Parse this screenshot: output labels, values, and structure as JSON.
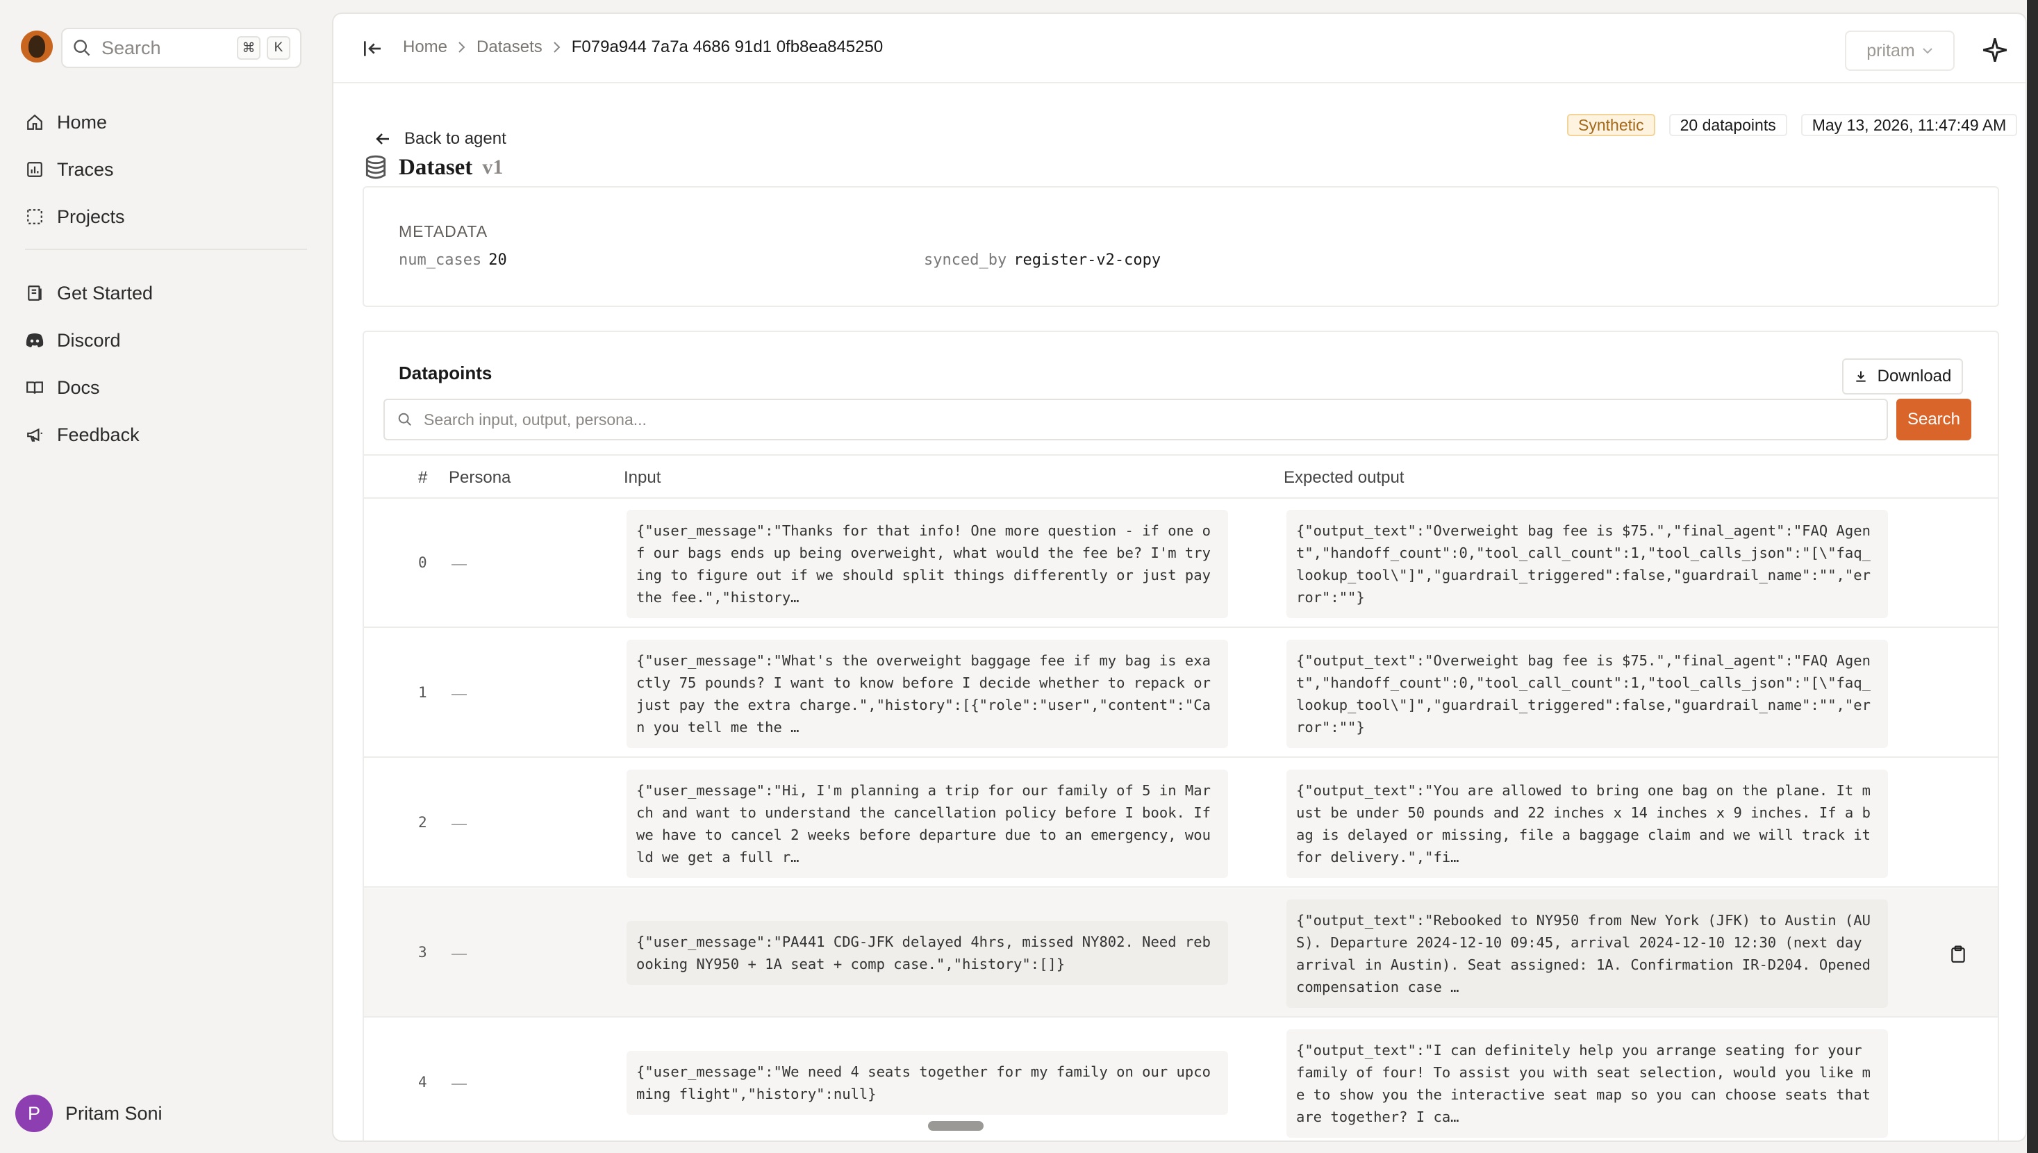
{
  "sidebar": {
    "search_placeholder": "Search",
    "shortcut_keys": [
      "⌘",
      "K"
    ],
    "nav_primary": [
      {
        "label": "Home",
        "icon": "home-icon"
      },
      {
        "label": "Traces",
        "icon": "chart-icon"
      },
      {
        "label": "Projects",
        "icon": "dotted-square-icon"
      }
    ],
    "nav_secondary": [
      {
        "label": "Get Started",
        "icon": "book-icon"
      },
      {
        "label": "Discord",
        "icon": "discord-icon"
      },
      {
        "label": "Docs",
        "icon": "docs-icon"
      },
      {
        "label": "Feedback",
        "icon": "megaphone-icon"
      }
    ],
    "user": {
      "initial": "P",
      "name": "Pritam Soni",
      "avatar_color": "#8d3fb1"
    }
  },
  "header": {
    "breadcrumb": [
      "Home",
      "Datasets"
    ],
    "current": "F079a944 7a7a 4686 91d1 0fb8ea845250",
    "user_select": "pritam"
  },
  "page": {
    "back_label": "Back to agent",
    "title": "Dataset",
    "version": "v1",
    "badges": {
      "type": "Synthetic",
      "count": "20 datapoints",
      "timestamp": "May 13, 2026, 11:47:49 AM"
    }
  },
  "metadata": {
    "label": "METADATA",
    "entries": [
      {
        "key": "num_cases",
        "value": "20"
      },
      {
        "key": "synced_by",
        "value": "register-v2-copy"
      }
    ]
  },
  "datapoints": {
    "title": "Datapoints",
    "download_label": "Download",
    "search_placeholder": "Search input, output, persona...",
    "search_button": "Search",
    "columns": [
      "#",
      "Persona",
      "Input",
      "Expected output"
    ],
    "rows": [
      {
        "index": "0",
        "input": "{\"user_message\":\"Thanks for that info! One more question - if one of our bags ends up being overweight, what would the fee be? I'm trying to figure out if we should split things differently or just pay the fee.\",\"history…",
        "output": "{\"output_text\":\"Overweight bag fee is $75.\",\"final_agent\":\"FAQ Agent\",\"handoff_count\":0,\"tool_call_count\":1,\"tool_calls_json\":\"[\\\"faq_lookup_tool\\\"]\",\"guardrail_triggered\":false,\"guardrail_name\":\"\",\"error\":\"\"}"
      },
      {
        "index": "1",
        "input": "{\"user_message\":\"What's the overweight baggage fee if my bag is exactly 75 pounds? I want to know before I decide whether to repack or just pay the extra charge.\",\"history\":[{\"role\":\"user\",\"content\":\"Can you tell me the …",
        "output": "{\"output_text\":\"Overweight bag fee is $75.\",\"final_agent\":\"FAQ Agent\",\"handoff_count\":0,\"tool_call_count\":1,\"tool_calls_json\":\"[\\\"faq_lookup_tool\\\"]\",\"guardrail_triggered\":false,\"guardrail_name\":\"\",\"error\":\"\"}"
      },
      {
        "index": "2",
        "input": "{\"user_message\":\"Hi, I'm planning a trip for our family of 5 in March and want to understand the cancellation policy before I book. If we have to cancel 2 weeks before departure due to an emergency, would we get a full r…",
        "output": "{\"output_text\":\"You are allowed to bring one bag on the plane. It must be under 50 pounds and 22 inches x 14 inches x 9 inches. If a bag is delayed or missing, file a baggage claim and we will track it for delivery.\",\"fi…"
      },
      {
        "index": "3",
        "input": "{\"user_message\":\"PA441 CDG-JFK delayed 4hrs, missed NY802. Need rebooking NY950 + 1A seat + comp case.\",\"history\":[]}",
        "output": "{\"output_text\":\"Rebooked to NY950 from New York (JFK) to Austin (AUS). Departure 2024-12-10 09:45, arrival 2024-12-10 12:30 (next day arrival in Austin). Seat assigned: 1A. Confirmation IR-D204. Opened compensation case …"
      },
      {
        "index": "4",
        "input": "{\"user_message\":\"We need 4 seats together for my family on our upcoming flight\",\"history\":null}",
        "output": "{\"output_text\":\"I can definitely help you arrange seating for your family of four! To assist you with seat selection, would you like me to show you the interactive seat map so you can choose seats that are together? I ca…"
      }
    ]
  },
  "colors": {
    "accent": "#d9652a",
    "synthetic_badge_bg": "#fdf3df",
    "synthetic_badge_text": "#a4691b"
  }
}
